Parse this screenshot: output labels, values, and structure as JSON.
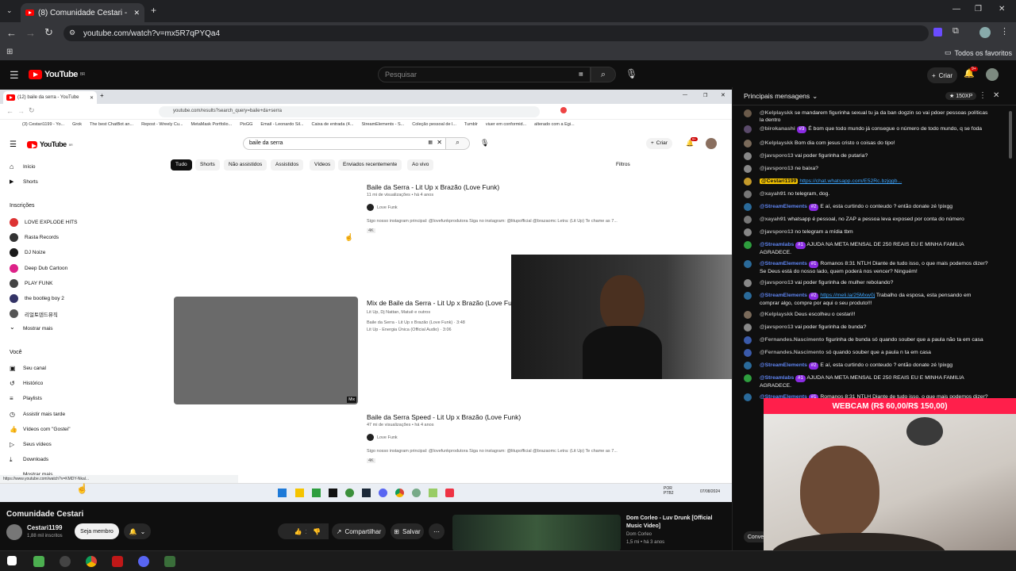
{
  "browser": {
    "tab_title": "(8) Comunidade Cestari - YouTu",
    "url": "youtube.com/watch?v=mx5R7qPYQa4",
    "bookmarks_all": "Todos os favoritos"
  },
  "youtube": {
    "logo": "YouTube",
    "region": "BR",
    "search_placeholder": "Pesquisar",
    "create_label": "Criar",
    "notif_count": "9+"
  },
  "inner": {
    "tab_title": "(12) baile da serra - YouTube",
    "url": "youtube.com/results?search_query=baile+da+serra",
    "bookmarks": [
      "(3) Cestari1199 - Yo...",
      "Grok",
      "The best ChatBot an...",
      "Repost - Wreely Cu...",
      "MetaMask Portfolio...",
      "PixGG",
      "Email - Leonardo Sil...",
      "Caixa de entrada (4...",
      "StreamElements - S...",
      "Coleção pessoal de l...",
      "Tumblr",
      "viuer em conformid...",
      "alterado com a Egi..."
    ],
    "logo": "YouTube",
    "region": "BR",
    "query": "baile da serra",
    "create": "Criar",
    "notif": "9+",
    "sidebar": {
      "home": "Início",
      "shorts": "Shorts",
      "subs_header": "Inscrições",
      "subs": [
        "LOVE EXPLODE HITS",
        "Rasta Records",
        "DJ Noize",
        "Deep Dub Cartoon",
        "PLAY FUNK",
        "the bootleg boy 2",
        "리얼토덴드뮤직"
      ],
      "show_more": "Mostrar mais",
      "you_header": "Você",
      "you_items": [
        "Seu canal",
        "Histórico",
        "Playlists",
        "Assistir mais tarde",
        "Vídeos com \"Gostei\"",
        "Seus vídeos",
        "Downloads",
        "Mostrar mais"
      ]
    },
    "chips": [
      "Tudo",
      "Shorts",
      "Não assistidos",
      "Assistidos",
      "Vídeos",
      "Enviados recentemente",
      "Ao vivo"
    ],
    "filters": "Filtros",
    "results": [
      {
        "title": "Baile da Serra - Lit Up x Brazão (Love Funk)",
        "meta": "11 mi de visualizações • há 4 anos",
        "channel": "Love Funk",
        "desc": "Sigo nosso instagram principal: @lovefunkprodutora Siga no instagram: @litupofficial @brazaomc Letra: (Lit Up) Te chame as 7...",
        "badge": "4K"
      },
      {
        "title": "Mix de Baile da Serra - Lit Up x Brazão (Love Funk)",
        "meta": "Lit Up, Dj Nattan, Matuê e outros",
        "sub1": "Baile da Serra - Lit Up x Brazão (Love Funk) · 3:48",
        "sub2": "Lit Up - Energia Única (Official Audio) · 3:06",
        "thumb_badge": "Mix"
      },
      {
        "title": "Baile da Serra Speed - Lit Up x Brazão (Love Funk)",
        "meta": "47 mi de visualizações • há 4 anos",
        "channel": "Love Funk",
        "desc": "Sigo nosso instagram principal: @lovefunkprodutora Siga no instagram: @litupofficial @brazaomc Letra: (Lit Up) Te chame as 7...",
        "badge": "4K"
      }
    ],
    "status_url": "https://www.youtube.com/watch?v=KMDY-Nkal...",
    "tray": {
      "lang": "POR",
      "lang2": "PTB2",
      "time": "07/08/2024"
    }
  },
  "chat": {
    "header": "Principais mensagens",
    "xp": "150XP",
    "messages": [
      {
        "author": "@Kelplayskk",
        "text": "se mandarem figurinha sexual tu ja da ban dogzin so vai pdoer pessoas políticas la dentro"
      },
      {
        "author": "@birokanashi",
        "badge": "#3",
        "text": "É bom que todo mundo já consegue o número de todo mundo, q se foda"
      },
      {
        "author": "@Kelplayskk",
        "text": "Bom dia com jesus cristo o coisas do tipo!"
      },
      {
        "author": "@javsporo13",
        "text": "vai poder figurinha de putaria?"
      },
      {
        "author": "@javsporo13",
        "text": "ne baixa?"
      },
      {
        "author": "@Cestari1199",
        "link": "https://chat.whatsapp.com/E52Rc.bzjqgb..."
      },
      {
        "author": "@xayah91",
        "text": "no telegram, dog."
      },
      {
        "author": "@StreamElements",
        "badge": "#2",
        "text": "E aí, esta curtindo o conteudo ? então donate zé !pixgg"
      },
      {
        "author": "@xayah91",
        "text": "whatsapp é pessoal, no ZAP a pessoa leva exposed por conta do número"
      },
      {
        "author": "@javsporo13",
        "text": "no telegram a mídia tbm"
      },
      {
        "author": "@Streamlabs",
        "badge": "#1",
        "text": "AJUDA NA META MENSAL DE 250 REAIS EU E MINHA FAMILIA AGRADECE."
      },
      {
        "author": "@StreamElements",
        "badge": "#1",
        "text": "Romanos 8:31 NTLH Diante de tudo isso, o que mais podemos dizer? Se Deus está do nosso lado, quem poderá nos vencer? Ninguém!"
      },
      {
        "author": "@javsporo13",
        "text": "vai poder figurinha de mulher rebolando?"
      },
      {
        "author": "@StreamElements",
        "badge": "#2",
        "link": "https://meli.la/25Mxw0j",
        "text": "Trabalho da esposa, esta pensando em comprar algo, compre por aqui o seu produto!!!"
      },
      {
        "author": "@Kelplayskk",
        "text": "Deus escolheu o cestari!!"
      },
      {
        "author": "@javsporo13",
        "text": "vai poder figurinha de bunda?"
      },
      {
        "author": "@Fernandes.Nascimento",
        "text": "figurinha de bunda só quando souber que a paula não ta em casa"
      },
      {
        "author": "@Fernandes.Nascimento",
        "text": "só quando souber que a paula n ta em casa"
      },
      {
        "author": "@StreamElements",
        "badge": "#2",
        "text": "E aí, esta curtindo o conteudo ? então donate zé !pixgg"
      },
      {
        "author": "@Streamlabs",
        "badge": "#1",
        "text": "AJUDA NA META MENSAL DE 250 REAIS EU E MINHA FAMILIA AGRADECE."
      },
      {
        "author": "@StreamElements",
        "badge": "#1",
        "text": "Romanos 8:31 NTLH Diante de tudo isso, o que mais podemos dizer?"
      }
    ],
    "webcam_banner": "WEBCAM (R$ 60,00/R$ 150,00)",
    "footer_button": "Conve"
  },
  "video": {
    "title": "Comunidade Cestari",
    "channel": "Cestari1199",
    "subs": "1,88 mil inscritos",
    "member": "Seja membro",
    "likes": "11",
    "share": "Compartilhar",
    "save": "Salvar"
  },
  "related": {
    "title": "Dom Corleo - Luv Drunk [Official Music Video]",
    "channel": "Dom Corleo",
    "meta": "1,5 mi • há 3 anos"
  },
  "colors": {
    "brand": "#ff0000",
    "accent": "#3ea6ff",
    "webcam": "#ff1f4b"
  }
}
